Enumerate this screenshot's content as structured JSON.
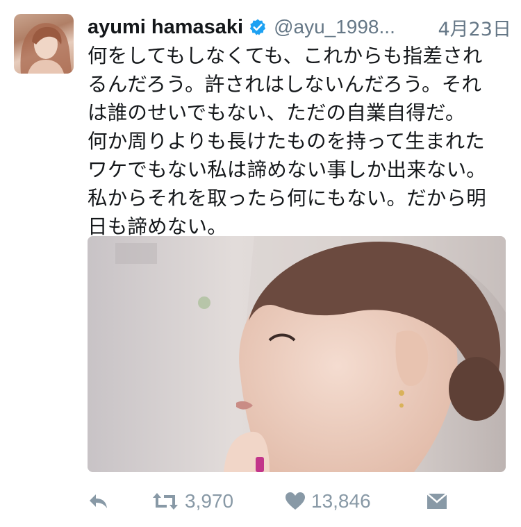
{
  "tweet": {
    "author": {
      "name": "ayumi hamasaki",
      "verified": true,
      "handle": "@ayu_1998...",
      "avatar_icon": "profile-photo"
    },
    "date": "4月23日",
    "text_lines": [
      "何をしてもしなくても、これからも指差され",
      "るんだろう。許されはしないんだろう。それ",
      "は誰のせいでもない、ただの自業自得だ。",
      "何か周りよりも長けたものを持って生まれた",
      "ワケでもない私は諦めない事しか出来ない。",
      "私からそれを取ったら何にもない。だから明",
      "日も諦めない。"
    ],
    "media": {
      "type": "photo",
      "icon": "photo-image"
    },
    "actions": {
      "reply_icon": "reply-icon",
      "retweet_icon": "retweet-icon",
      "retweet_count": "3,970",
      "like_icon": "heart-icon",
      "like_count": "13,846",
      "dm_icon": "envelope-icon"
    }
  },
  "colors": {
    "verified_blue": "#1da1f2",
    "secondary_text": "#657786",
    "icon_gray": "#8899a6"
  }
}
